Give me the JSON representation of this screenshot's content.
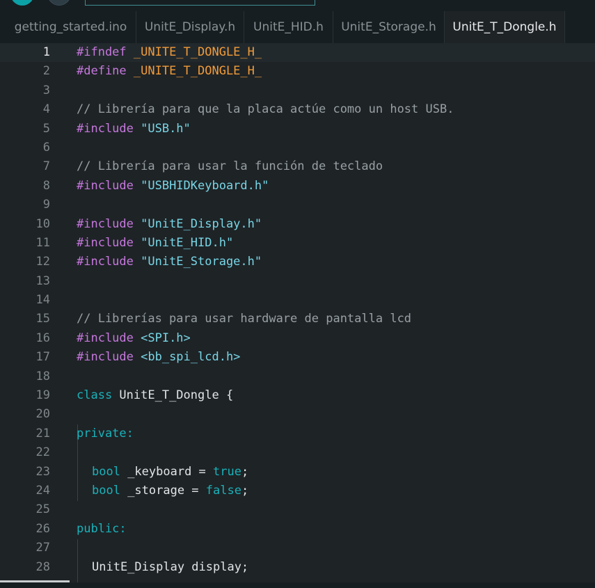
{
  "tabs": [
    {
      "label": "getting_started.ino",
      "active": false
    },
    {
      "label": "UnitE_Display.h",
      "active": false
    },
    {
      "label": "UnitE_HID.h",
      "active": false
    },
    {
      "label": "UnitE_Storage.h",
      "active": false
    },
    {
      "label": "UnitE_T_Dongle.h",
      "active": true
    }
  ],
  "editor": {
    "current_line": 1,
    "lines": [
      {
        "num": "1",
        "tokens": [
          {
            "t": "#ifndef ",
            "c": "pre"
          },
          {
            "t": "_UNITE_T_DONGLE_H_",
            "c": "macro"
          }
        ]
      },
      {
        "num": "2",
        "tokens": [
          {
            "t": "#define ",
            "c": "pre"
          },
          {
            "t": "_UNITE_T_DONGLE_H_",
            "c": "macro"
          }
        ]
      },
      {
        "num": "3",
        "tokens": []
      },
      {
        "num": "4",
        "tokens": [
          {
            "t": "// Librería para que la placa actúe como un host USB.",
            "c": "com"
          }
        ]
      },
      {
        "num": "5",
        "tokens": [
          {
            "t": "#include ",
            "c": "pre"
          },
          {
            "t": "\"USB.h\"",
            "c": "str"
          }
        ]
      },
      {
        "num": "6",
        "tokens": []
      },
      {
        "num": "7",
        "tokens": [
          {
            "t": "// Librería para usar la función de teclado",
            "c": "com"
          }
        ]
      },
      {
        "num": "8",
        "tokens": [
          {
            "t": "#include ",
            "c": "pre"
          },
          {
            "t": "\"USBHIDKeyboard.h\"",
            "c": "str"
          }
        ]
      },
      {
        "num": "9",
        "tokens": []
      },
      {
        "num": "10",
        "tokens": [
          {
            "t": "#include ",
            "c": "pre"
          },
          {
            "t": "\"UnitE_Display.h\"",
            "c": "str"
          }
        ]
      },
      {
        "num": "11",
        "tokens": [
          {
            "t": "#include ",
            "c": "pre"
          },
          {
            "t": "\"UnitE_HID.h\"",
            "c": "str"
          }
        ]
      },
      {
        "num": "12",
        "tokens": [
          {
            "t": "#include ",
            "c": "pre"
          },
          {
            "t": "\"UnitE_Storage.h\"",
            "c": "str"
          }
        ]
      },
      {
        "num": "13",
        "tokens": []
      },
      {
        "num": "14",
        "tokens": []
      },
      {
        "num": "15",
        "tokens": [
          {
            "t": "// Librerías para usar hardware de pantalla lcd",
            "c": "com"
          }
        ]
      },
      {
        "num": "16",
        "tokens": [
          {
            "t": "#include ",
            "c": "pre"
          },
          {
            "t": "<SPI.h>",
            "c": "str"
          }
        ]
      },
      {
        "num": "17",
        "tokens": [
          {
            "t": "#include ",
            "c": "pre"
          },
          {
            "t": "<bb_spi_lcd.h>",
            "c": "str"
          }
        ]
      },
      {
        "num": "18",
        "tokens": []
      },
      {
        "num": "19",
        "tokens": [
          {
            "t": "class ",
            "c": "kw"
          },
          {
            "t": "UnitE_T_Dongle {",
            "c": "id"
          }
        ]
      },
      {
        "num": "20",
        "tokens": []
      },
      {
        "num": "21",
        "tokens": [
          {
            "t": "private:",
            "c": "kw"
          }
        ]
      },
      {
        "num": "22",
        "tokens": []
      },
      {
        "num": "23",
        "indent": true,
        "tokens": [
          {
            "t": "bool ",
            "c": "kw"
          },
          {
            "t": "_keyboard = ",
            "c": "id"
          },
          {
            "t": "true",
            "c": "kw"
          },
          {
            "t": ";",
            "c": "id"
          }
        ]
      },
      {
        "num": "24",
        "indent": true,
        "tokens": [
          {
            "t": "bool ",
            "c": "kw"
          },
          {
            "t": "_storage = ",
            "c": "id"
          },
          {
            "t": "false",
            "c": "kw"
          },
          {
            "t": ";",
            "c": "id"
          }
        ]
      },
      {
        "num": "25",
        "tokens": []
      },
      {
        "num": "26",
        "tokens": [
          {
            "t": "public:",
            "c": "kw"
          }
        ]
      },
      {
        "num": "27",
        "tokens": []
      },
      {
        "num": "28",
        "indent": true,
        "tokens": [
          {
            "t": "UnitE_Display display;",
            "c": "id"
          }
        ]
      }
    ]
  }
}
